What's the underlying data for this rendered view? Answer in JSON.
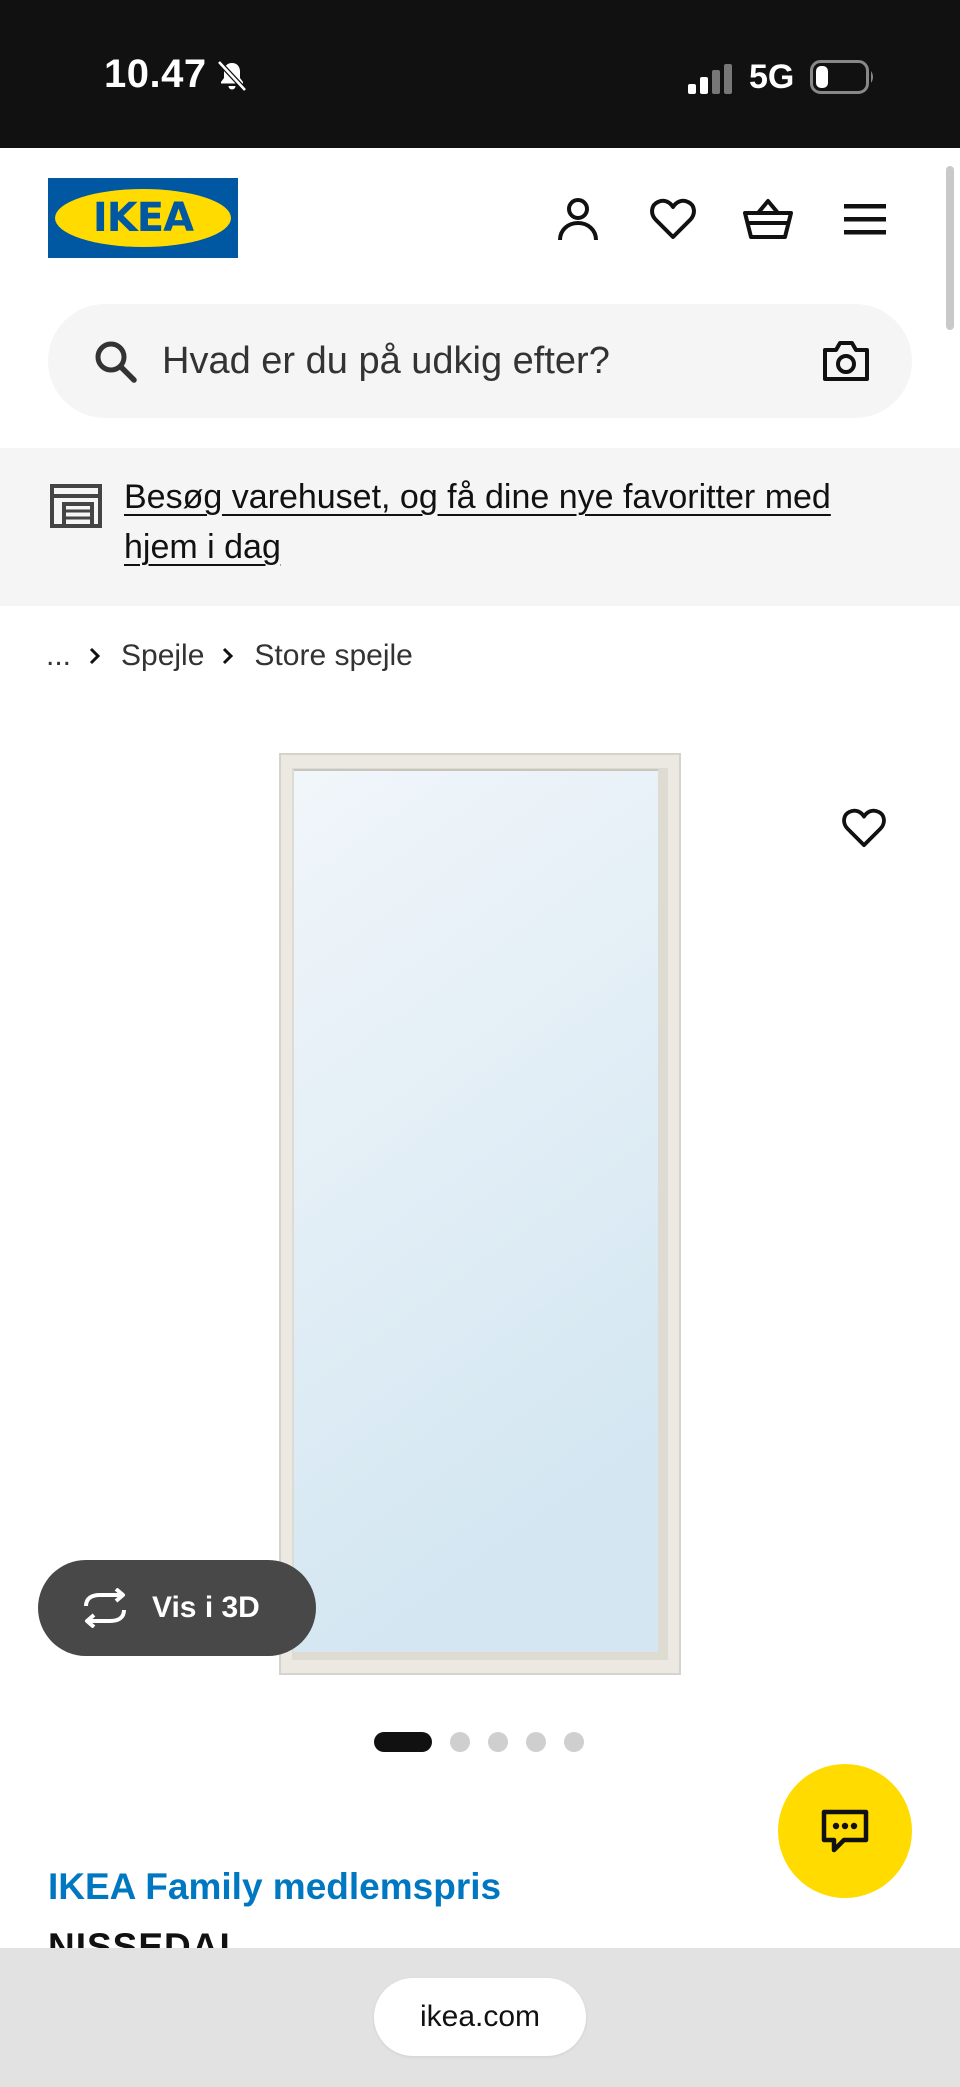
{
  "status_bar": {
    "time": "10.47",
    "network": "5G"
  },
  "header": {
    "logo_text": "IKEA",
    "brand_colors": {
      "blue": "#0058a3",
      "yellow": "#ffdb00"
    },
    "icons": [
      "profile-icon",
      "heart-icon",
      "basket-icon",
      "menu-icon"
    ]
  },
  "search": {
    "placeholder": "Hvad er du på udkig efter?"
  },
  "banner": {
    "text": "Besøg varehuset, og få dine nye favoritter med hjem i dag"
  },
  "breadcrumb": {
    "items": [
      "...",
      "Spejle",
      "Store spejle"
    ]
  },
  "gallery": {
    "view_3d_label": "Vis i 3D",
    "dot_count": 5,
    "active_dot": 0
  },
  "product": {
    "family_price_label": "IKEA Family medlemspris",
    "name": "NISSEDAL"
  },
  "browser": {
    "url": "ikea.com"
  },
  "colors": {
    "family_blue": "#0077c1",
    "chat_yellow": "#ffdb00"
  }
}
